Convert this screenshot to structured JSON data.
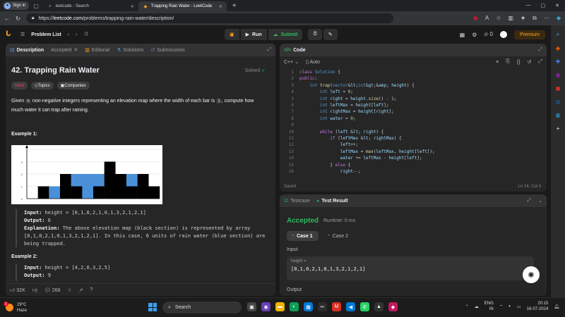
{
  "browser": {
    "signin_label": "Sign in",
    "tabs": [
      {
        "title": "leetcode - Search",
        "icon": "search-icon",
        "active": false
      },
      {
        "title": "Trapping Rain Water - LeetCode",
        "icon": "leetcode-icon",
        "active": true
      }
    ],
    "url_prefix": "https://",
    "url_domain": "leetcode.com",
    "url_path": "/problems/trapping-rain-water/description/"
  },
  "lc_nav": {
    "problem_list": "Problem List",
    "run_label": "Run",
    "submit_label": "Submit",
    "fire_count": "0",
    "premium_label": "Premium"
  },
  "left_panel": {
    "tabs": [
      "Description",
      "Accepted",
      "Editorial",
      "Solutions",
      "Submissions"
    ],
    "title": "42. Trapping Rain Water",
    "solved_label": "Solved",
    "tags": [
      "Hard",
      "Topics",
      "Companies"
    ],
    "desc_part1": "Given",
    "desc_code_n": "n",
    "desc_part2": "non-negative integers representing an elevation map where the width of each bar is",
    "desc_code_1": "1",
    "desc_part3": ", compute how much water it can trap after raining.",
    "example1_heading": "Example 1:",
    "example1": {
      "input_label": "Input:",
      "input_value": "height = [0,1,0,2,1,0,1,3,2,1,2,1]",
      "output_label": "Output:",
      "output_value": "6",
      "explanation_label": "Explanation:",
      "explanation_value": "The above elevation map (black section) is represented by array [0,1,0,2,1,0,1,3,2,1,2,1]. In this case, 6 units of rain water (blue section) are being trapped."
    },
    "example2_heading": "Example 2:",
    "example2": {
      "input_label": "Input:",
      "input_value": "height = [4,2,0,3,2,5]",
      "output_label": "Output:",
      "output_value": "9"
    },
    "likes": "32K",
    "comments": "268"
  },
  "chart_data": {
    "type": "bar",
    "categories": [
      "0",
      "1",
      "2",
      "3",
      "4",
      "5",
      "6",
      "7",
      "8",
      "9",
      "10",
      "11"
    ],
    "series": [
      {
        "values": [
          0,
          1,
          0,
          2,
          1,
          0,
          1,
          3,
          2,
          1,
          2,
          1
        ],
        "color": "#000000"
      },
      {
        "values": [
          0,
          0,
          1,
          0,
          1,
          2,
          1,
          0,
          0,
          1,
          0,
          0
        ],
        "color": "#4a90d9"
      }
    ],
    "ylim": [
      0,
      4
    ],
    "yticks": [
      "0",
      "1",
      "2",
      "3"
    ],
    "grid": true
  },
  "code_panel": {
    "title": "Code",
    "language": "C++",
    "autocomplete": "Auto",
    "saved_label": "Saved",
    "cursor_pos": "Ln 24, Col 3",
    "lines": [
      {
        "n": "1",
        "text": "class Solution {"
      },
      {
        "n": "2",
        "text": "public:"
      },
      {
        "n": "3",
        "text": "    int trap(vector<int>& height) {"
      },
      {
        "n": "4",
        "text": "        int left = 0;"
      },
      {
        "n": "5",
        "text": "        int right = height.size() - 1;"
      },
      {
        "n": "6",
        "text": "        int leftMax = height[left];"
      },
      {
        "n": "7",
        "text": "        int rightMax = height[right];"
      },
      {
        "n": "8",
        "text": "        int water = 0;"
      },
      {
        "n": "9",
        "text": ""
      },
      {
        "n": "10",
        "text": "        while (left < right) {"
      },
      {
        "n": "11",
        "text": "            if (leftMax < rightMax) {"
      },
      {
        "n": "12",
        "text": "                left++;"
      },
      {
        "n": "13",
        "text": "                leftMax = max(leftMax, height[left]);"
      },
      {
        "n": "14",
        "text": "                water += leftMax - height[left];"
      },
      {
        "n": "15",
        "text": "            } else {"
      },
      {
        "n": "16",
        "text": "                right--;"
      }
    ]
  },
  "test_panel": {
    "testcase_tab": "Testcase",
    "result_tab": "Test Result",
    "status": "Accepted",
    "runtime": "Runtime: 0 ms",
    "cases": [
      "Case 1",
      "Case 2"
    ],
    "input_label": "Input",
    "input_key": "height =",
    "input_value": "[0,1,0,2,1,0,1,3,2,1,2,1]",
    "output_label": "Output"
  },
  "taskbar": {
    "temperature": "29°C",
    "condition": "Haze",
    "weather_badge": "1",
    "search_label": "Search",
    "lang_top": "ENG",
    "lang_bottom": "IN",
    "time": "20:15",
    "date": "16-07-2024"
  }
}
